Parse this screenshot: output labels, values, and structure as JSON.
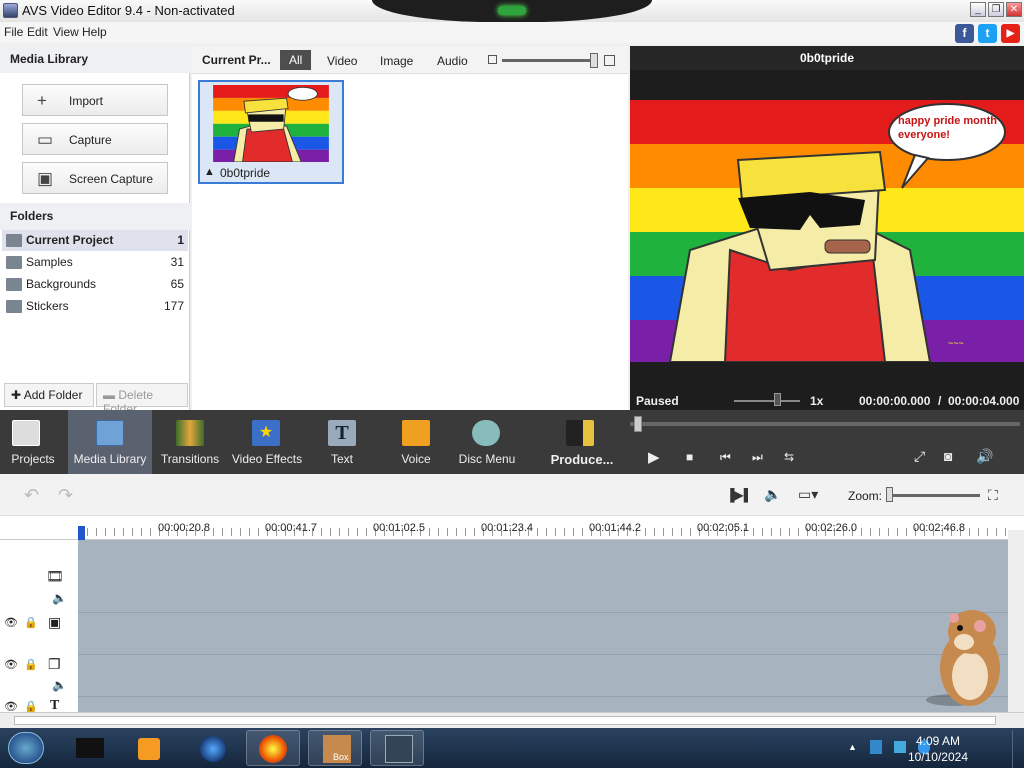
{
  "window": {
    "title": "AVS Video Editor 9.4 - Non-activated"
  },
  "menu": [
    "File",
    "Edit",
    "View",
    "Help"
  ],
  "social": [
    {
      "label": "f",
      "color": "#3b5998"
    },
    {
      "label": "t",
      "color": "#1da1f2"
    },
    {
      "label": "▶",
      "color": "#e62117"
    }
  ],
  "library": {
    "title": "Media Library",
    "buttons": [
      {
        "label": "Import",
        "icon": "+"
      },
      {
        "label": "Capture",
        "icon": "▭"
      },
      {
        "label": "Screen Capture",
        "icon": "▣"
      }
    ],
    "folders_title": "Folders",
    "folders": [
      {
        "name": "Current Project",
        "count": "1"
      },
      {
        "name": "Samples",
        "count": "31"
      },
      {
        "name": "Backgrounds",
        "count": "65"
      },
      {
        "name": "Stickers",
        "count": "177"
      }
    ],
    "add_folder": "Add Folder",
    "delete_folder": "Delete Folder"
  },
  "center": {
    "title": "Current Pr...",
    "tabs": [
      "All",
      "Video",
      "Image",
      "Audio"
    ],
    "thumb_name": "0b0tpride"
  },
  "preview": {
    "title": "0b0tpride",
    "speech": "happy pride month everyone!",
    "status": "Paused",
    "speed": "1x",
    "time_current": "00:00:00.000",
    "separator": "/",
    "time_total": "00:00:04.000"
  },
  "tools": [
    {
      "label": "Projects",
      "color": "#ddd"
    },
    {
      "label": "Media Library",
      "color": "#6fa3d8"
    },
    {
      "label": "Transitions",
      "color": "#e2a63c"
    },
    {
      "label": "Video Effects",
      "color": "#3c6fc8"
    },
    {
      "label": "Text",
      "color": "#9ab"
    },
    {
      "label": "Voice",
      "color": "#f0a020"
    },
    {
      "label": "Disc Menu",
      "color": "#8bb"
    },
    {
      "label": "Produce...",
      "color": "#e8c040"
    }
  ],
  "timeline": {
    "zoom_label": "Zoom:",
    "ticks": [
      "00:00:20.8",
      "00:00:41.7",
      "00:01:02.5",
      "00:01:23.4",
      "00:01:44.2",
      "00:02:05.1",
      "00:02:26.0",
      "00:02:46.8"
    ]
  },
  "taskbar": {
    "time": "4:09 AM",
    "date": "10/10/2024",
    "box_label": "Box"
  }
}
